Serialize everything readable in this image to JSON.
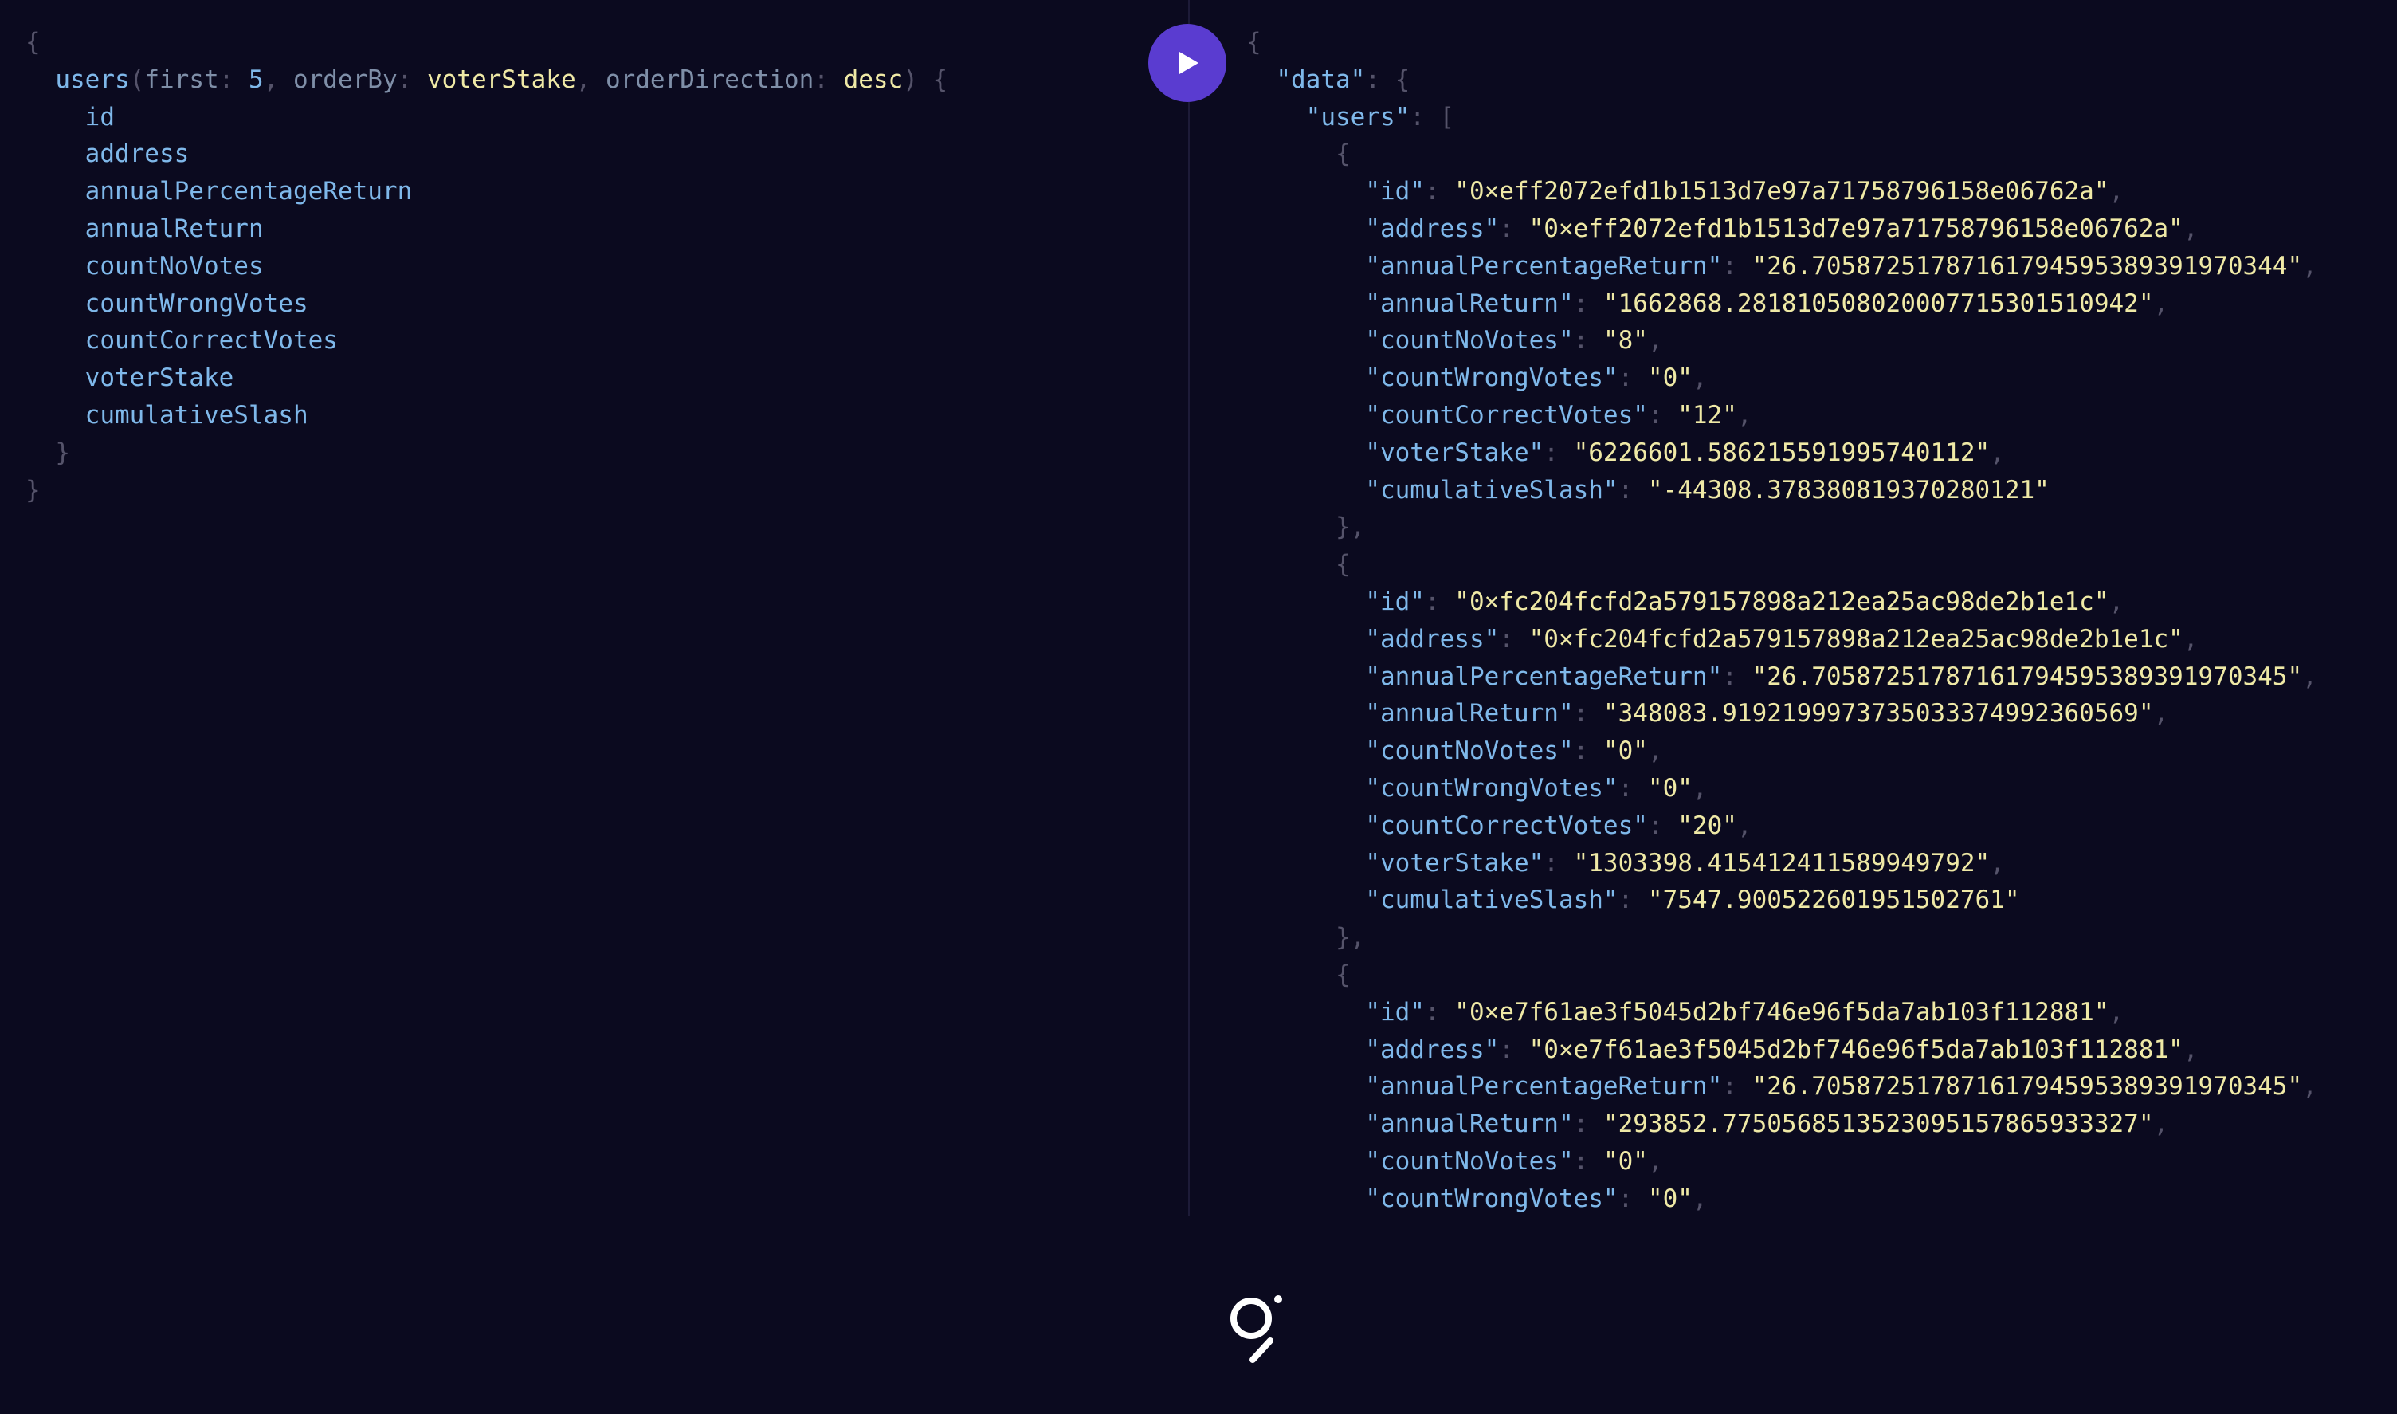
{
  "query": {
    "open_brace": "{",
    "field": "users",
    "arg1_name": "first",
    "arg1_value": "5",
    "arg2_name": "orderBy",
    "arg2_value": "voterStake",
    "arg3_name": "orderDirection",
    "arg3_value": "desc",
    "selections": [
      "id",
      "address",
      "annualPercentageReturn",
      "annualReturn",
      "countNoVotes",
      "countWrongVotes",
      "countCorrectVotes",
      "voterStake",
      "cumulativeSlash"
    ],
    "close_inner": "}",
    "close_outer": "}"
  },
  "result": {
    "data_key": "\"data\"",
    "users_key": "\"users\"",
    "users": [
      {
        "id": "\"0×eff2072efd1b1513d7e97a71758796158e06762a\"",
        "address": "\"0×eff2072efd1b1513d7e97a71758796158e06762a\"",
        "annualPercentageReturn": "\"26.705872517871617945953893919703​44\"",
        "annualReturn": "\"1662868.281810508020007715301510942\"",
        "countNoVotes": "\"8\"",
        "countWrongVotes": "\"0\"",
        "countCorrectVotes": "\"12\"",
        "voterStake": "\"6226601.586215591995740112\"",
        "cumulativeSlash": "\"-44308.378380819370280121\""
      },
      {
        "id": "\"0×fc204fcfd2a579157898a212ea25ac98de2b1e1c\"",
        "address": "\"0×fc204fcfd2a579157898a212ea25ac98de2b1e1c\"",
        "annualPercentageReturn": "\"26.70587251787161794595389391970345\"",
        "annualReturn": "\"348083.9192199973735033374992360569\"",
        "countNoVotes": "\"0\"",
        "countWrongVotes": "\"0\"",
        "countCorrectVotes": "\"20\"",
        "voterStake": "\"1303398.415412411589949792\"",
        "cumulativeSlash": "\"7547.900522601951502761\""
      },
      {
        "id": "\"0×e7f61ae3f5045d2bf746e96f5da7ab103f112881\"",
        "address": "\"0×e7f61ae3f5045d2bf746e96f5da7ab103f112881\"",
        "annualPercentageReturn": "\"26.70587251787161794595389391970345\"",
        "annualReturn": "\"293852.7750568513523095157865933327\"",
        "countNoVotes": "\"0\"",
        "countWrongVotes": "\"0\""
      }
    ]
  },
  "labels": {
    "key_id": "\"id\"",
    "key_address": "\"address\"",
    "key_apr": "\"annualPercentageReturn\"",
    "key_annualReturn": "\"annualReturn\"",
    "key_countNoVotes": "\"countNoVotes\"",
    "key_countWrongVotes": "\"countWrongVotes\"",
    "key_countCorrectVotes": "\"countCorrectVotes\"",
    "key_voterStake": "\"voterStake\"",
    "key_cumulativeSlash": "\"cumulativeSlash\""
  },
  "icons": {
    "run": "play-icon",
    "logo": "the-graph-logo-icon"
  },
  "colors": {
    "background": "#0b0a1f",
    "accent": "#5a3cd0",
    "field": "#7fb8ea",
    "string": "#efe9a6",
    "punctuation": "#55536a"
  }
}
